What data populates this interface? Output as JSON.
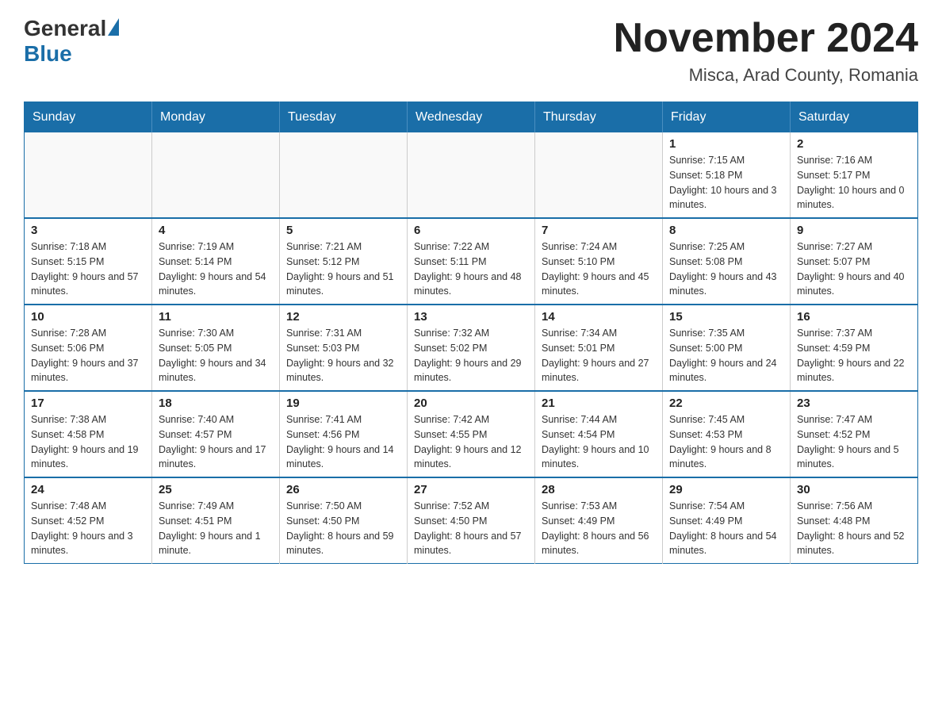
{
  "header": {
    "logo_general": "General",
    "logo_blue": "Blue",
    "month_title": "November 2024",
    "location": "Misca, Arad County, Romania"
  },
  "days_of_week": [
    "Sunday",
    "Monday",
    "Tuesday",
    "Wednesday",
    "Thursday",
    "Friday",
    "Saturday"
  ],
  "weeks": [
    [
      {
        "day": "",
        "sunrise": "",
        "sunset": "",
        "daylight": "",
        "empty": true
      },
      {
        "day": "",
        "sunrise": "",
        "sunset": "",
        "daylight": "",
        "empty": true
      },
      {
        "day": "",
        "sunrise": "",
        "sunset": "",
        "daylight": "",
        "empty": true
      },
      {
        "day": "",
        "sunrise": "",
        "sunset": "",
        "daylight": "",
        "empty": true
      },
      {
        "day": "",
        "sunrise": "",
        "sunset": "",
        "daylight": "",
        "empty": true
      },
      {
        "day": "1",
        "sunrise": "Sunrise: 7:15 AM",
        "sunset": "Sunset: 5:18 PM",
        "daylight": "Daylight: 10 hours and 3 minutes.",
        "empty": false
      },
      {
        "day": "2",
        "sunrise": "Sunrise: 7:16 AM",
        "sunset": "Sunset: 5:17 PM",
        "daylight": "Daylight: 10 hours and 0 minutes.",
        "empty": false
      }
    ],
    [
      {
        "day": "3",
        "sunrise": "Sunrise: 7:18 AM",
        "sunset": "Sunset: 5:15 PM",
        "daylight": "Daylight: 9 hours and 57 minutes.",
        "empty": false
      },
      {
        "day": "4",
        "sunrise": "Sunrise: 7:19 AM",
        "sunset": "Sunset: 5:14 PM",
        "daylight": "Daylight: 9 hours and 54 minutes.",
        "empty": false
      },
      {
        "day": "5",
        "sunrise": "Sunrise: 7:21 AM",
        "sunset": "Sunset: 5:12 PM",
        "daylight": "Daylight: 9 hours and 51 minutes.",
        "empty": false
      },
      {
        "day": "6",
        "sunrise": "Sunrise: 7:22 AM",
        "sunset": "Sunset: 5:11 PM",
        "daylight": "Daylight: 9 hours and 48 minutes.",
        "empty": false
      },
      {
        "day": "7",
        "sunrise": "Sunrise: 7:24 AM",
        "sunset": "Sunset: 5:10 PM",
        "daylight": "Daylight: 9 hours and 45 minutes.",
        "empty": false
      },
      {
        "day": "8",
        "sunrise": "Sunrise: 7:25 AM",
        "sunset": "Sunset: 5:08 PM",
        "daylight": "Daylight: 9 hours and 43 minutes.",
        "empty": false
      },
      {
        "day": "9",
        "sunrise": "Sunrise: 7:27 AM",
        "sunset": "Sunset: 5:07 PM",
        "daylight": "Daylight: 9 hours and 40 minutes.",
        "empty": false
      }
    ],
    [
      {
        "day": "10",
        "sunrise": "Sunrise: 7:28 AM",
        "sunset": "Sunset: 5:06 PM",
        "daylight": "Daylight: 9 hours and 37 minutes.",
        "empty": false
      },
      {
        "day": "11",
        "sunrise": "Sunrise: 7:30 AM",
        "sunset": "Sunset: 5:05 PM",
        "daylight": "Daylight: 9 hours and 34 minutes.",
        "empty": false
      },
      {
        "day": "12",
        "sunrise": "Sunrise: 7:31 AM",
        "sunset": "Sunset: 5:03 PM",
        "daylight": "Daylight: 9 hours and 32 minutes.",
        "empty": false
      },
      {
        "day": "13",
        "sunrise": "Sunrise: 7:32 AM",
        "sunset": "Sunset: 5:02 PM",
        "daylight": "Daylight: 9 hours and 29 minutes.",
        "empty": false
      },
      {
        "day": "14",
        "sunrise": "Sunrise: 7:34 AM",
        "sunset": "Sunset: 5:01 PM",
        "daylight": "Daylight: 9 hours and 27 minutes.",
        "empty": false
      },
      {
        "day": "15",
        "sunrise": "Sunrise: 7:35 AM",
        "sunset": "Sunset: 5:00 PM",
        "daylight": "Daylight: 9 hours and 24 minutes.",
        "empty": false
      },
      {
        "day": "16",
        "sunrise": "Sunrise: 7:37 AM",
        "sunset": "Sunset: 4:59 PM",
        "daylight": "Daylight: 9 hours and 22 minutes.",
        "empty": false
      }
    ],
    [
      {
        "day": "17",
        "sunrise": "Sunrise: 7:38 AM",
        "sunset": "Sunset: 4:58 PM",
        "daylight": "Daylight: 9 hours and 19 minutes.",
        "empty": false
      },
      {
        "day": "18",
        "sunrise": "Sunrise: 7:40 AM",
        "sunset": "Sunset: 4:57 PM",
        "daylight": "Daylight: 9 hours and 17 minutes.",
        "empty": false
      },
      {
        "day": "19",
        "sunrise": "Sunrise: 7:41 AM",
        "sunset": "Sunset: 4:56 PM",
        "daylight": "Daylight: 9 hours and 14 minutes.",
        "empty": false
      },
      {
        "day": "20",
        "sunrise": "Sunrise: 7:42 AM",
        "sunset": "Sunset: 4:55 PM",
        "daylight": "Daylight: 9 hours and 12 minutes.",
        "empty": false
      },
      {
        "day": "21",
        "sunrise": "Sunrise: 7:44 AM",
        "sunset": "Sunset: 4:54 PM",
        "daylight": "Daylight: 9 hours and 10 minutes.",
        "empty": false
      },
      {
        "day": "22",
        "sunrise": "Sunrise: 7:45 AM",
        "sunset": "Sunset: 4:53 PM",
        "daylight": "Daylight: 9 hours and 8 minutes.",
        "empty": false
      },
      {
        "day": "23",
        "sunrise": "Sunrise: 7:47 AM",
        "sunset": "Sunset: 4:52 PM",
        "daylight": "Daylight: 9 hours and 5 minutes.",
        "empty": false
      }
    ],
    [
      {
        "day": "24",
        "sunrise": "Sunrise: 7:48 AM",
        "sunset": "Sunset: 4:52 PM",
        "daylight": "Daylight: 9 hours and 3 minutes.",
        "empty": false
      },
      {
        "day": "25",
        "sunrise": "Sunrise: 7:49 AM",
        "sunset": "Sunset: 4:51 PM",
        "daylight": "Daylight: 9 hours and 1 minute.",
        "empty": false
      },
      {
        "day": "26",
        "sunrise": "Sunrise: 7:50 AM",
        "sunset": "Sunset: 4:50 PM",
        "daylight": "Daylight: 8 hours and 59 minutes.",
        "empty": false
      },
      {
        "day": "27",
        "sunrise": "Sunrise: 7:52 AM",
        "sunset": "Sunset: 4:50 PM",
        "daylight": "Daylight: 8 hours and 57 minutes.",
        "empty": false
      },
      {
        "day": "28",
        "sunrise": "Sunrise: 7:53 AM",
        "sunset": "Sunset: 4:49 PM",
        "daylight": "Daylight: 8 hours and 56 minutes.",
        "empty": false
      },
      {
        "day": "29",
        "sunrise": "Sunrise: 7:54 AM",
        "sunset": "Sunset: 4:49 PM",
        "daylight": "Daylight: 8 hours and 54 minutes.",
        "empty": false
      },
      {
        "day": "30",
        "sunrise": "Sunrise: 7:56 AM",
        "sunset": "Sunset: 4:48 PM",
        "daylight": "Daylight: 8 hours and 52 minutes.",
        "empty": false
      }
    ]
  ]
}
